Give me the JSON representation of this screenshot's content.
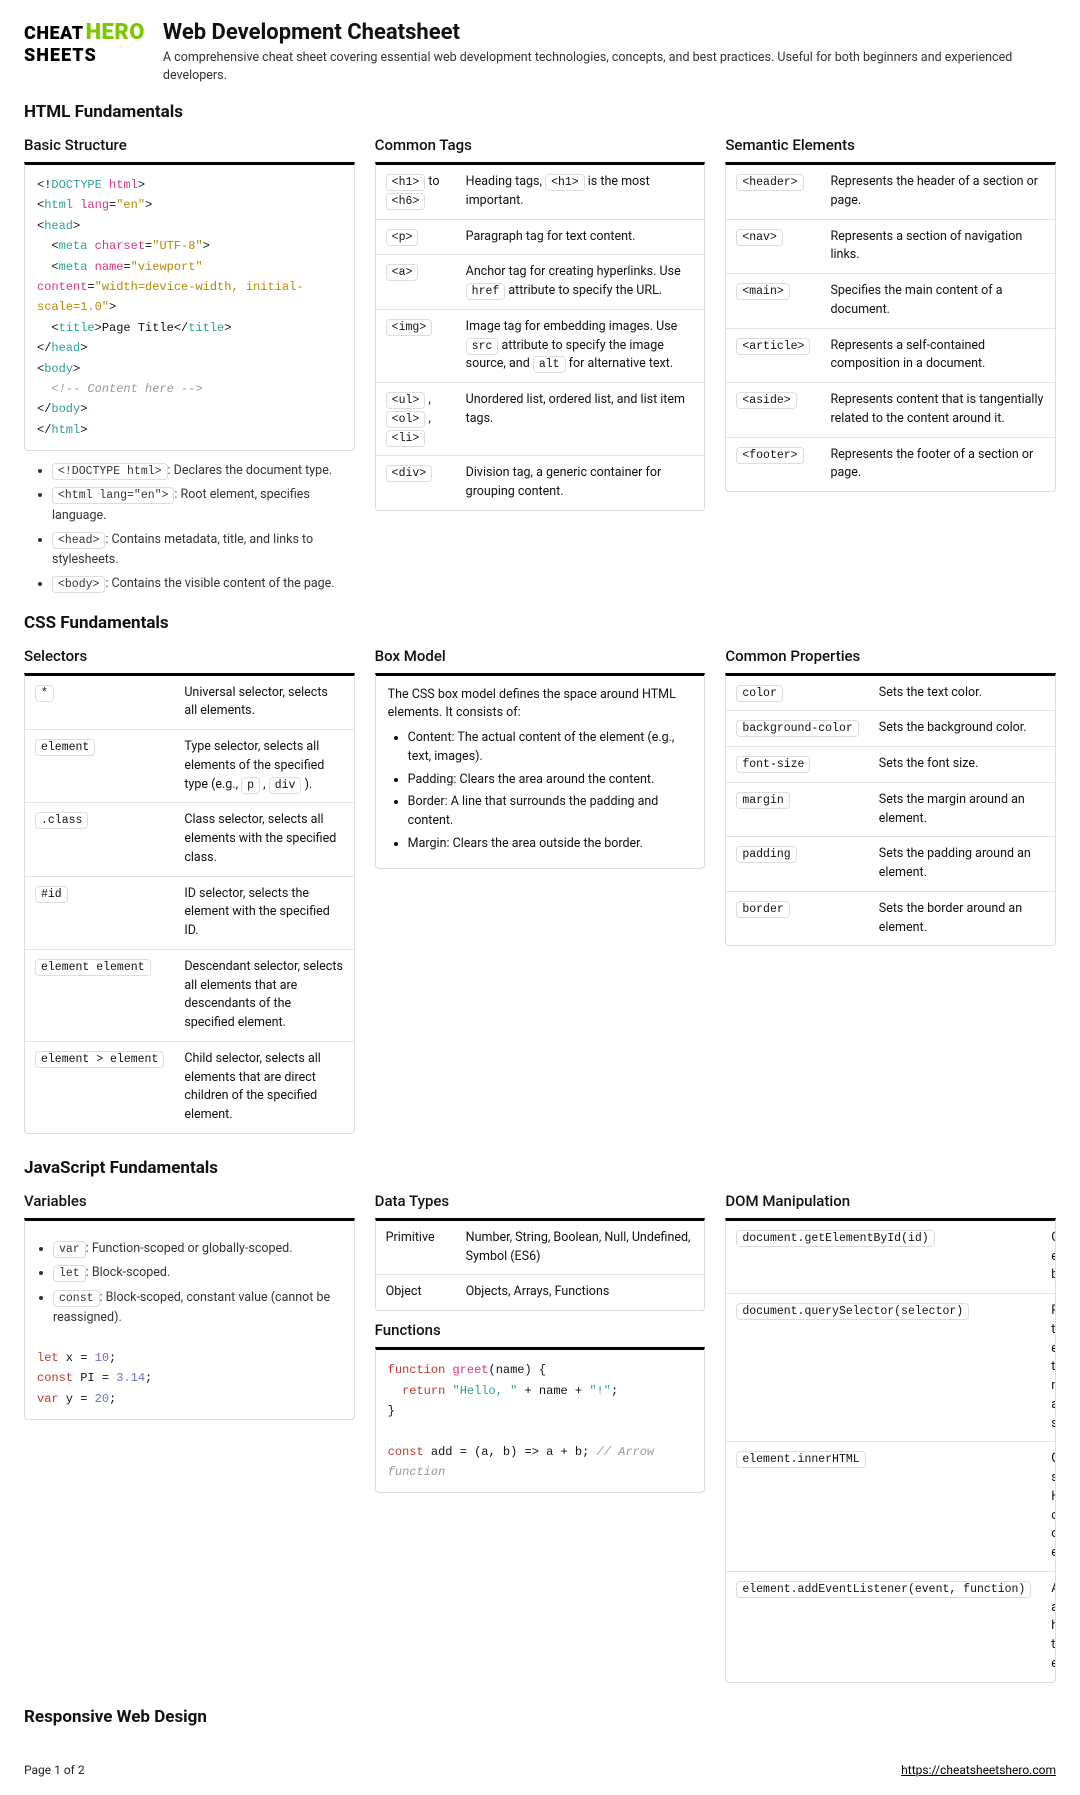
{
  "logo": {
    "part1": "CHEAT",
    "part2": "HERO",
    "part3": "SHEETS"
  },
  "title": "Web Development Cheatsheet",
  "subtitle": "A comprehensive cheat sheet covering essential web development technologies, concepts, and best practices. Useful for both beginners and experienced developers.",
  "sections": {
    "html": {
      "heading": "HTML Fundamentals",
      "basic": {
        "heading": "Basic Structure",
        "notes": [
          {
            "code": "<!DOCTYPE html>",
            "text": ": Declares the document type."
          },
          {
            "code": "<html lang=\"en\">",
            "text": ": Root element, specifies language."
          },
          {
            "code": "<head>",
            "text": ": Contains metadata, title, and links to stylesheets."
          },
          {
            "code": "<body>",
            "text": ": Contains the visible content of the page."
          }
        ]
      },
      "tags": {
        "heading": "Common Tags",
        "rows": [
          {
            "k": [
              "<h1>",
              " to ",
              "<h6>"
            ],
            "v": [
              "Heading tags, ",
              "<h1>",
              " is the most important."
            ]
          },
          {
            "k": [
              "<p>"
            ],
            "v": [
              "Paragraph tag for text content."
            ]
          },
          {
            "k": [
              "<a>"
            ],
            "v": [
              "Anchor tag for creating hyperlinks. Use ",
              "href",
              " attribute to specify the URL."
            ]
          },
          {
            "k": [
              "<img>"
            ],
            "v": [
              "Image tag for embedding images. Use ",
              "src",
              " attribute to specify the image source, and ",
              "alt",
              " for alternative text."
            ]
          },
          {
            "k": [
              "<ul>",
              " , ",
              "<ol>",
              " , ",
              "<li>"
            ],
            "v": [
              "Unordered list, ordered list, and list item tags."
            ]
          },
          {
            "k": [
              "<div>"
            ],
            "v": [
              "Division tag, a generic container for grouping content."
            ]
          }
        ]
      },
      "semantic": {
        "heading": "Semantic Elements",
        "rows": [
          {
            "k": "<header>",
            "v": "Represents the header of a section or page."
          },
          {
            "k": "<nav>",
            "v": "Represents a section of navigation links."
          },
          {
            "k": "<main>",
            "v": "Specifies the main content of a document."
          },
          {
            "k": "<article>",
            "v": "Represents a self-contained composition in a document."
          },
          {
            "k": "<aside>",
            "v": "Represents content that is tangentially related to the content around it."
          },
          {
            "k": "<footer>",
            "v": "Represents the footer of a section or page."
          }
        ]
      }
    },
    "css": {
      "heading": "CSS Fundamentals",
      "selectors": {
        "heading": "Selectors",
        "rows": [
          {
            "k": [
              "*"
            ],
            "v": [
              "Universal selector, selects all elements."
            ]
          },
          {
            "k": [
              "element"
            ],
            "v": [
              "Type selector, selects all elements of the specified type (e.g., ",
              "p",
              " , ",
              "div",
              " )."
            ]
          },
          {
            "k": [
              ".class"
            ],
            "v": [
              "Class selector, selects all elements with the specified class."
            ]
          },
          {
            "k": [
              "#id"
            ],
            "v": [
              "ID selector, selects the element with the specified ID."
            ]
          },
          {
            "k": [
              "element element"
            ],
            "v": [
              "Descendant selector, selects all elements that are descendants of the specified element."
            ]
          },
          {
            "k": [
              "element > element"
            ],
            "v": [
              "Child selector, selects all elements that are direct children of the specified element."
            ]
          }
        ]
      },
      "box": {
        "heading": "Box Model",
        "intro": "The CSS box model defines the space around HTML elements. It consists of:",
        "items": [
          {
            "b": "Content:",
            "t": " The actual content of the element (e.g., text, images)."
          },
          {
            "b": "Padding:",
            "t": " Clears the area around the content."
          },
          {
            "b": "Border:",
            "t": " A line that surrounds the padding and content."
          },
          {
            "b": "Margin:",
            "t": " Clears the area outside the border."
          }
        ]
      },
      "props": {
        "heading": "Common Properties",
        "rows": [
          {
            "k": "color",
            "v": "Sets the text color."
          },
          {
            "k": "background-color",
            "v": "Sets the background color."
          },
          {
            "k": "font-size",
            "v": "Sets the font size."
          },
          {
            "k": "margin",
            "v": "Sets the margin around an element."
          },
          {
            "k": "padding",
            "v": "Sets the padding around an element."
          },
          {
            "k": "border",
            "v": "Sets the border around an element."
          }
        ]
      }
    },
    "js": {
      "heading": "JavaScript Fundamentals",
      "vars": {
        "heading": "Variables",
        "notes": [
          {
            "code": "var",
            "text": ": Function-scoped or globally-scoped."
          },
          {
            "code": "let",
            "text": ": Block-scoped."
          },
          {
            "code": "const",
            "text": ": Block-scoped, constant value (cannot be reassigned)."
          }
        ]
      },
      "types": {
        "heading": "Data Types",
        "rows": [
          {
            "k": "Primitive",
            "v": "Number, String, Boolean, Null, Undefined, Symbol (ES6)"
          },
          {
            "k": "Object",
            "v": "Objects, Arrays, Functions"
          }
        ]
      },
      "funcs": {
        "heading": "Functions"
      },
      "dom": {
        "heading": "DOM Manipulation",
        "rows": [
          {
            "k": "document.getElementById(id)",
            "v": "Gets an element by its ID."
          },
          {
            "k": "document.querySelector(selector)",
            "v": "Returns the first element that matches a CSS selector."
          },
          {
            "k": "element.innerHTML",
            "v": "Gets or sets the HTML content of an element."
          },
          {
            "k": "element.addEventListener(event, function)",
            "v": "Attaches an event handler to an element."
          }
        ]
      }
    },
    "rwd": {
      "heading": "Responsive Web Design"
    }
  },
  "footer": {
    "page": "Page 1 of 2",
    "link": "https://cheatsheetshero.com"
  }
}
